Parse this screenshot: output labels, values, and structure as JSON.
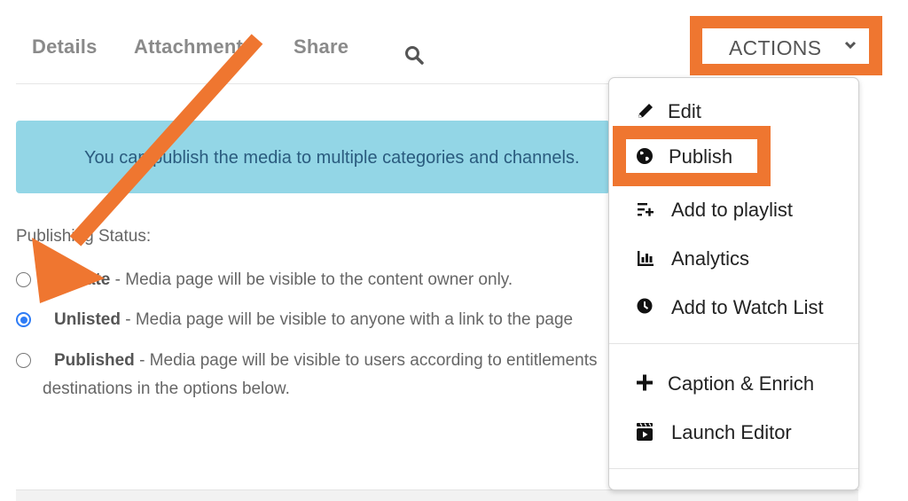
{
  "tabs": [
    {
      "label": "Details"
    },
    {
      "label": "Attachments"
    },
    {
      "label": "Share"
    }
  ],
  "search": {
    "icon": "search-icon"
  },
  "actions": {
    "label": "ACTIONS",
    "icon": "chevron-down-icon",
    "highlight_color": "#ef7630"
  },
  "alert": {
    "text": "You can publish the media to multiple categories and channels.",
    "bg_color": "#93d6e6"
  },
  "publishing": {
    "label": "Publishing Status:",
    "options": [
      {
        "name": "Private",
        "desc": " - Media page will be visible to the content owner only.",
        "checked": false
      },
      {
        "name": "Unlisted",
        "desc": " - Media page will be visible to anyone with a link to the page",
        "checked": true
      },
      {
        "name": "Published",
        "desc": " - Media page will be visible to users according to entitlements",
        "desc_line2": "destinations in the options below.",
        "checked": false
      }
    ]
  },
  "dropdown": {
    "items": [
      {
        "label": "Edit",
        "icon": "pencil-icon"
      },
      {
        "label": "Publish",
        "icon": "globe-icon",
        "highlighted": true
      },
      {
        "label": "Add to playlist",
        "icon": "playlist-add-icon"
      },
      {
        "label": "Analytics",
        "icon": "bar-chart-icon"
      },
      {
        "label": "Add to Watch List",
        "icon": "clock-icon"
      },
      {
        "label": "Caption & Enrich",
        "icon": "plus-icon"
      },
      {
        "label": "Launch Editor",
        "icon": "clapperboard-icon"
      }
    ]
  },
  "annotation": {
    "arrow_color": "#ef7630"
  }
}
